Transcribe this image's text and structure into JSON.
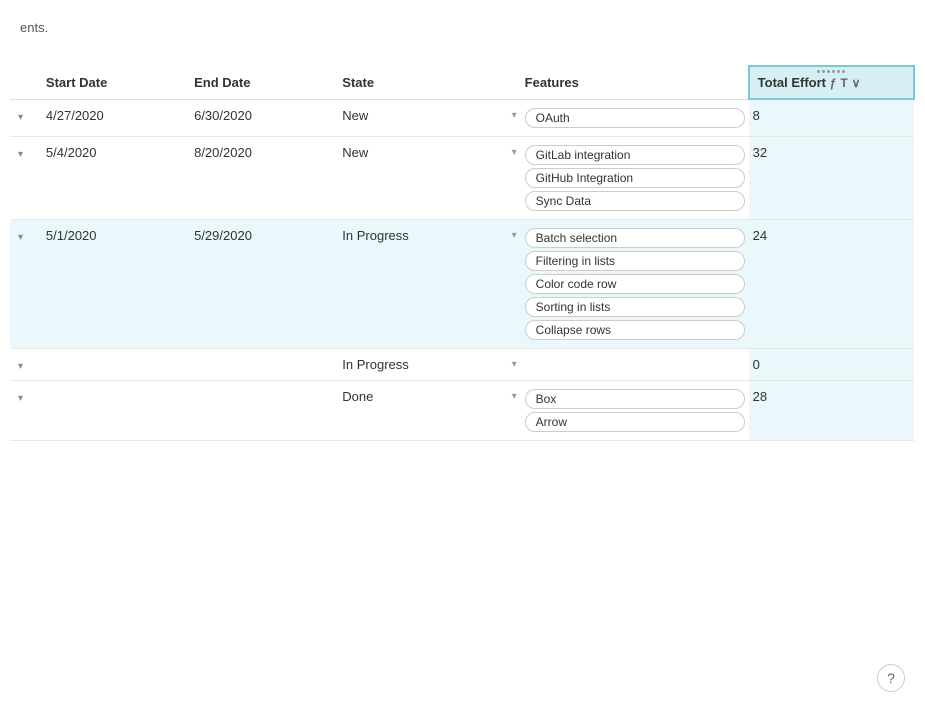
{
  "intro": {
    "text": "ents."
  },
  "table": {
    "columns": [
      {
        "key": "expand",
        "label": ""
      },
      {
        "key": "start_date",
        "label": "Start Date"
      },
      {
        "key": "end_date",
        "label": "End Date"
      },
      {
        "key": "state",
        "label": "State"
      },
      {
        "key": "features",
        "label": "Features"
      },
      {
        "key": "total_effort",
        "label": "Total Effort"
      }
    ],
    "header_icons": {
      "formula": "ƒ",
      "text": "T",
      "chevron": "∨"
    },
    "rows": [
      {
        "id": 1,
        "expand": "▾",
        "start_date": "4/27/2020",
        "end_date": "6/30/2020",
        "state": "New",
        "features": [
          "OAuth"
        ],
        "total_effort": "8"
      },
      {
        "id": 2,
        "expand": "▾",
        "start_date": "5/4/2020",
        "end_date": "8/20/2020",
        "state": "New",
        "features": [
          "GitLab integration",
          "GitHub Integration",
          "Sync Data"
        ],
        "total_effort": "32"
      },
      {
        "id": 3,
        "expand": "▾",
        "start_date": "5/1/2020",
        "end_date": "5/29/2020",
        "state": "In Progress",
        "features": [
          "Batch selection",
          "Filtering in lists",
          "Color code row",
          "Sorting in lists",
          "Collapse rows"
        ],
        "total_effort": "24",
        "highlighted": true
      },
      {
        "id": 4,
        "expand": "▾",
        "start_date": "",
        "end_date": "",
        "state": "In Progress",
        "features": [],
        "total_effort": "0"
      },
      {
        "id": 5,
        "expand": "▾",
        "start_date": "",
        "end_date": "",
        "state": "Done",
        "features": [
          "Box",
          "Arrow"
        ],
        "total_effort": "28"
      }
    ]
  },
  "help": {
    "label": "?"
  }
}
